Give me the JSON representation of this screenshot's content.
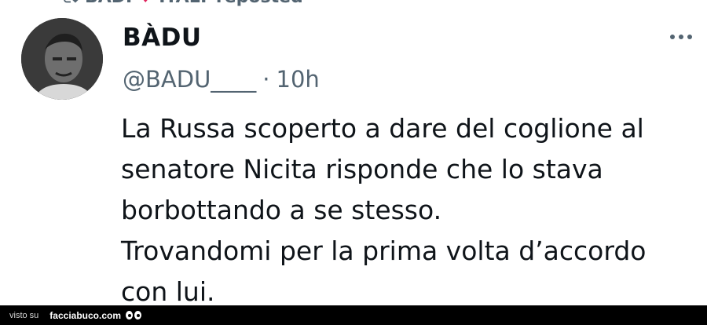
{
  "repost": {
    "text_start": "BADI",
    "text_end": "ITALY reposted",
    "icon": "repost-icon",
    "heart_icon": "heart-icon"
  },
  "post": {
    "display_name": "BÀDU",
    "handle": "@BADU____",
    "separator": "·",
    "time": "10h",
    "text_lines": [
      "La Russa scoperto a dare del coglione al",
      "senatore Nicita risponde che lo stava",
      "borbottando a se stesso.",
      "Trovandomi per la prima volta d’accordo",
      "con lui."
    ],
    "more_icon": "more-options-icon"
  },
  "footer": {
    "visto": "visto su",
    "brand": "facciabuco.com"
  },
  "colors": {
    "text": "#0f1419",
    "secondary": "#536471",
    "heart": "#e0245e",
    "footer_bg": "#000000"
  }
}
